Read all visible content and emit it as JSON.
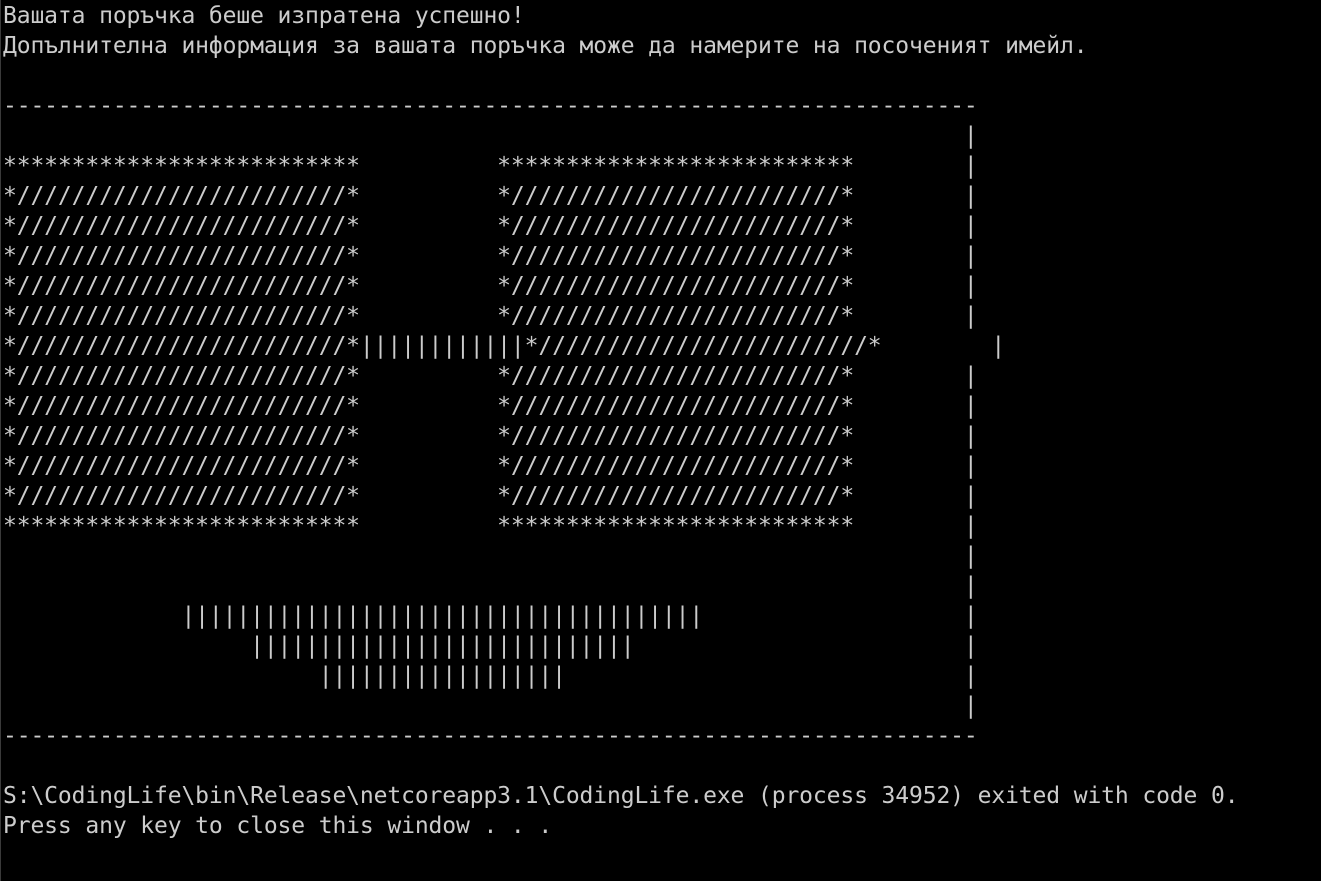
{
  "console": {
    "lines": [
      "Вашата поръчка беше изпратена успешно!",
      "Допълнителна информация за вашата поръчка може да намерите на посоченият имейл.",
      "",
      "-----------------------------------------------------------------------",
      "                                                                      |",
      "**************************          **************************        |",
      "*////////////////////////*          *////////////////////////*        |",
      "*////////////////////////*          *////////////////////////*        |",
      "*////////////////////////*          *////////////////////////*        |",
      "*////////////////////////*          *////////////////////////*        |",
      "*////////////////////////*          *////////////////////////*        |",
      "*////////////////////////*||||||||||||*////////////////////////*        |",
      "*////////////////////////*          *////////////////////////*        |",
      "*////////////////////////*          *////////////////////////*        |",
      "*////////////////////////*          *////////////////////////*        |",
      "*////////////////////////*          *////////////////////////*        |",
      "*////////////////////////*          *////////////////////////*        |",
      "**************************          **************************        |",
      "                                                                      |",
      "                                                                      |",
      "             ||||||||||||||||||||||||||||||||||||||                   |",
      "                  ||||||||||||||||||||||||||||                        |",
      "                       ||||||||||||||||||                             |",
      "                                                                      |",
      "-----------------------------------------------------------------------",
      "",
      "S:\\CodingLife\\bin\\Release\\netcoreapp3.1\\CodingLife.exe (process 34952) exited with code 0.",
      "Press any key to close this window . . ."
    ]
  }
}
